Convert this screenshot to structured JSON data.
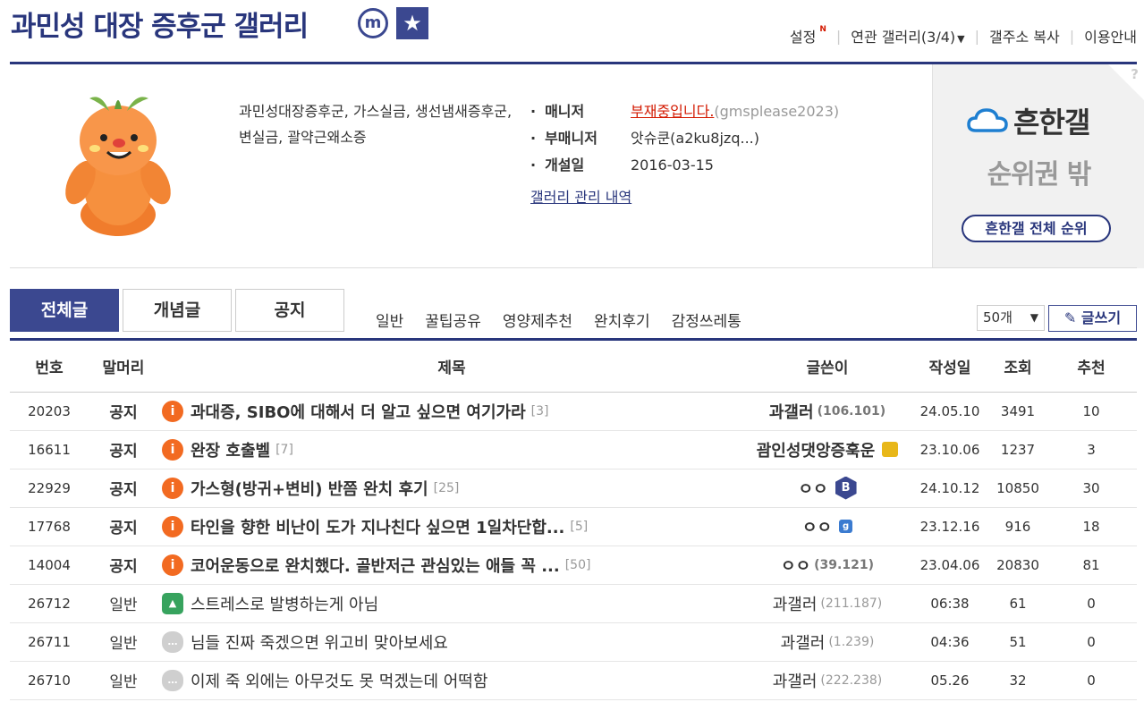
{
  "header": {
    "title": "과민성 대장 증후군 갤러리",
    "mark_m": "m",
    "mark_star": "★",
    "links": {
      "settings": "설정",
      "settings_new": "N",
      "related": "연관 갤러리(3/4)",
      "copy_address": "갤주소 복사",
      "help": "이용안내"
    }
  },
  "info": {
    "description": "과민성대장증후군, 가스실금, 생선냄새증후군, 변실금, 괄약근왜소증",
    "manager_label": "매니저",
    "manager_status": "부재중입니다.",
    "manager_id": "(gmsplease2023)",
    "submanager_label": "부매니저",
    "submanager_value": "앗슈쿤(a2ku8jzq...)",
    "opened_label": "개설일",
    "opened_value": "2016-03-15",
    "manage_link": "갤러리 관리 내역"
  },
  "rank": {
    "question": "?",
    "logo": "흔한갤",
    "out_text": "순위권 밖",
    "all_button": "흔한갤 전체 순위"
  },
  "tabs": [
    "전체글",
    "개념글",
    "공지"
  ],
  "heads": [
    "일반",
    "꿀팁공유",
    "영양제추천",
    "완치후기",
    "감정쓰레통"
  ],
  "count_select": "50개",
  "write_button": "글쓰기",
  "columns": [
    "번호",
    "말머리",
    "제목",
    "글쓴이",
    "작성일",
    "조회",
    "추천"
  ],
  "posts": [
    {
      "num": "20203",
      "head": "공지",
      "type": "notice",
      "title": "과대증, SIBO에 대해서 더 알고 싶으면 여기가라",
      "replies": "[3]",
      "writer": "과갤러",
      "ip": "(106.101)",
      "badge": "",
      "date": "24.05.10",
      "views": "3491",
      "recs": "10"
    },
    {
      "num": "16611",
      "head": "공지",
      "type": "notice",
      "title": "완장 호출벨",
      "replies": "[7]",
      "writer": "괌인성댓앙증훅운",
      "ip": "",
      "badge": "gold",
      "date": "23.10.06",
      "views": "1237",
      "recs": "3"
    },
    {
      "num": "22929",
      "head": "공지",
      "type": "notice",
      "title": "가스형(방귀+변비) 반쯤 완치 후기",
      "replies": "[25]",
      "writer": "ㅇㅇ",
      "ip": "",
      "badge": "hex",
      "date": "24.10.12",
      "views": "10850",
      "recs": "30"
    },
    {
      "num": "17768",
      "head": "공지",
      "type": "notice",
      "title": "타인을 향한 비난이 도가 지나친다 싶으면 1일차단합...",
      "replies": "[5]",
      "writer": "ㅇㅇ",
      "ip": "",
      "badge": "sq",
      "date": "23.12.16",
      "views": "916",
      "recs": "18"
    },
    {
      "num": "14004",
      "head": "공지",
      "type": "notice",
      "title": "코어운동으로 완치했다. 골반저근 관심있는 애들 꼭 ...",
      "replies": "[50]",
      "writer": "ㅇㅇ",
      "ip": "(39.121)",
      "badge": "",
      "date": "23.04.06",
      "views": "20830",
      "recs": "81"
    },
    {
      "num": "26712",
      "head": "일반",
      "type": "img",
      "title": "스트레스로 발병하는게 아님",
      "replies": "",
      "writer": "과갤러",
      "ip": "(211.187)",
      "badge": "",
      "date": "06:38",
      "views": "61",
      "recs": "0"
    },
    {
      "num": "26711",
      "head": "일반",
      "type": "txt",
      "title": "님들 진짜 죽겠으면 위고비 맞아보세요",
      "replies": "",
      "writer": "과갤러",
      "ip": "(1.239)",
      "badge": "",
      "date": "04:36",
      "views": "51",
      "recs": "0"
    },
    {
      "num": "26710",
      "head": "일반",
      "type": "txt",
      "title": "이제 죽 외에는 아무것도 못 먹겠는데 어떡함",
      "replies": "",
      "writer": "과갤러",
      "ip": "(222.238)",
      "badge": "",
      "date": "05.26",
      "views": "32",
      "recs": "0"
    }
  ]
}
